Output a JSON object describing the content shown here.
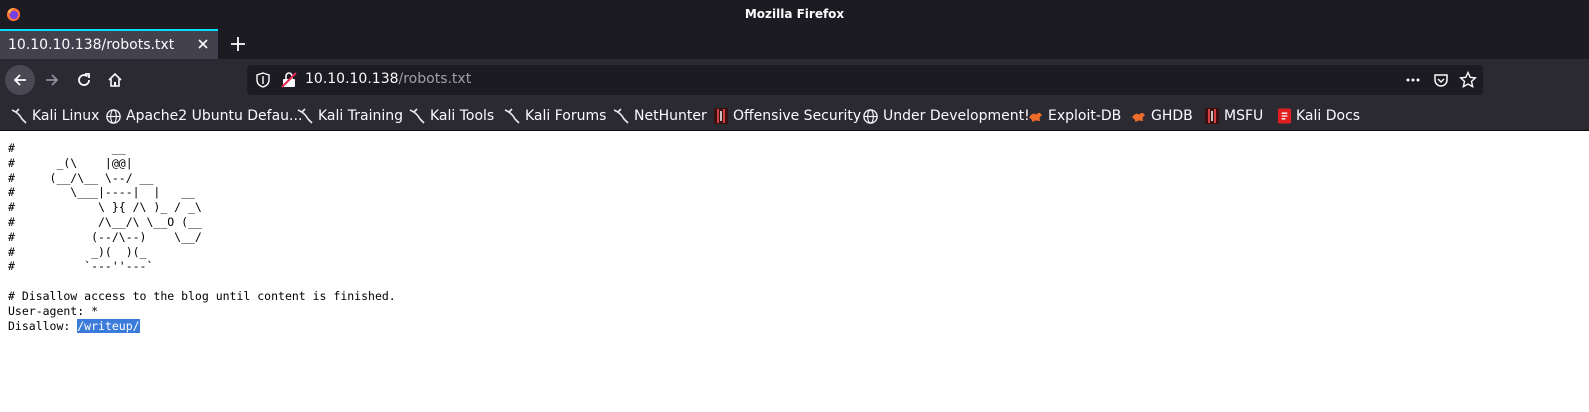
{
  "window": {
    "title": "Mozilla Firefox"
  },
  "tabs": [
    {
      "label": "10.10.10.138/robots.txt"
    }
  ],
  "urlbar": {
    "host": "10.10.10.138",
    "path": "/robots.txt"
  },
  "bookmarks": [
    {
      "label": "Kali Linux",
      "icon": "kali-dragon-icon"
    },
    {
      "label": "Apache2 Ubuntu Defau...",
      "icon": "globe-icon"
    },
    {
      "label": "Kali Training",
      "icon": "kali-dragon-icon"
    },
    {
      "label": "Kali Tools",
      "icon": "kali-dragon-icon"
    },
    {
      "label": "Kali Forums",
      "icon": "kali-dragon-icon"
    },
    {
      "label": "NetHunter",
      "icon": "kali-dragon-icon"
    },
    {
      "label": "Offensive Security",
      "icon": "offsec-icon"
    },
    {
      "label": "Under Development!",
      "icon": "globe-icon"
    },
    {
      "label": "Exploit-DB",
      "icon": "exploitdb-icon"
    },
    {
      "label": "GHDB",
      "icon": "exploitdb-icon"
    },
    {
      "label": "MSFU",
      "icon": "offsec-icon"
    },
    {
      "label": "Kali Docs",
      "icon": "kali-docs-icon"
    }
  ],
  "page": {
    "art_lines": [
      "#              __",
      "#      _(\\    |@@|",
      "#     (__/\\__ \\--/ __",
      "#        \\___|----|  |   __",
      "#            \\ }{ /\\ )_ / _\\",
      "#            /\\__/\\ \\__O (__",
      "#           (--/\\--)    \\__/",
      "#           _)(  )(_",
      "#          `---''---`"
    ],
    "comment": "# Disallow access to the blog until content is finished.",
    "user_agent": "User-agent: *",
    "disallow_label": "Disallow: ",
    "disallow_path": "/writeup/"
  },
  "colors": {
    "tab_accent": "#00ddff",
    "selection": "#3b7bd9"
  }
}
